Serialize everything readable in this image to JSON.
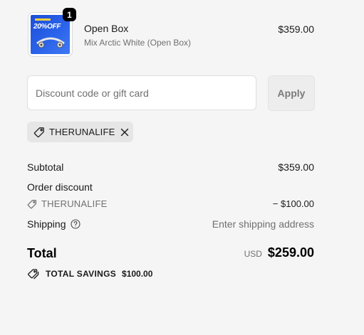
{
  "product": {
    "thumbnail_sale_text": "20%OFF",
    "quantity_badge": "1",
    "title": "Open Box",
    "variant": "Mix Arctic White (Open Box)",
    "price": "$359.00"
  },
  "discount": {
    "placeholder": "Discount code or gift card",
    "value": "",
    "apply_label": "Apply",
    "applied_code": "THERUNALIFE"
  },
  "summary": {
    "subtotal_label": "Subtotal",
    "subtotal_value": "$359.00",
    "order_discount_label": "Order discount",
    "discount_code": "THERUNALIFE",
    "discount_value": "− $100.00",
    "shipping_label": "Shipping",
    "shipping_value": "Enter shipping address",
    "total_label": "Total",
    "currency": "USD",
    "total_value": "$259.00",
    "savings_label": "TOTAL SAVINGS",
    "savings_value": "$100.00"
  },
  "icons": {
    "tag": "tag-icon",
    "close": "close-icon",
    "help": "help-circle-icon",
    "savings": "tags-icon"
  }
}
